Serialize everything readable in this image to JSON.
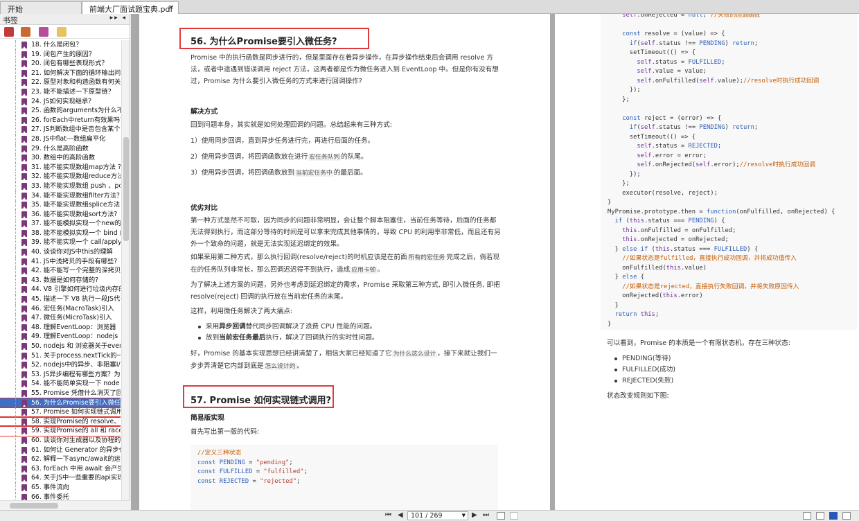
{
  "tabs": [
    {
      "label": "开始",
      "closable": false
    },
    {
      "label": "前端大厂面试题宝典.pdf",
      "closable": true,
      "close_glyph": "×"
    }
  ],
  "sidebar": {
    "title": "书签",
    "collapse_glyph": "▸▸ ◂",
    "bookmarks": [
      {
        "label": "18. 什么是闭包？"
      },
      {
        "label": "19. 闭包产生的原因？"
      },
      {
        "label": "20. 闭包有哪些表现形式？"
      },
      {
        "label": "21. 如何解决下面的循环输出问题"
      },
      {
        "label": "22. 原型对象和构造函数有何关系"
      },
      {
        "label": "23. 能不能描述一下原型链？"
      },
      {
        "label": "24. JS如何实现继承？"
      },
      {
        "label": "25. 函数的arguments为什么不是"
      },
      {
        "label": "26. forEach中return有效果吗？如"
      },
      {
        "label": "27. JS判断数组中是否包含某个值"
      },
      {
        "label": "28. JS中flat---数组扁平化"
      },
      {
        "label": "29. 什么是高阶函数"
      },
      {
        "label": "30. 数组中的高阶函数"
      },
      {
        "label": "31. 能不能实现数组map方法 ?"
      },
      {
        "label": "32. 能不能实现数组reduce方法"
      },
      {
        "label": "33. 能不能实现数组 push 、pop"
      },
      {
        "label": "34. 能不能实现数组filter方法？"
      },
      {
        "label": "35. 能不能实现数组splice方法 ?"
      },
      {
        "label": "36. 能不能实现数组sort方法?"
      },
      {
        "label": "37. 能不能模拟实现一个new的效"
      },
      {
        "label": "38. 能不能模拟实现一个 bind 的效"
      },
      {
        "label": "39. 能不能实现一个 call/apply 函"
      },
      {
        "label": "40. 谈谈你对JS中this的理解"
      },
      {
        "label": "41. JS中浅拷贝的手段有哪些?"
      },
      {
        "label": "42. 能不能写一个完整的深拷贝?"
      },
      {
        "label": "43. 数据是如何存储的?"
      },
      {
        "label": "44. V8 引擎如何进行垃圾内存的回"
      },
      {
        "label": "45. 描述一下 V8 执行一段JS代码"
      },
      {
        "label": "46. 宏任务(MacroTask)引入"
      },
      {
        "label": "47. 微任务(MicroTask)引入"
      },
      {
        "label": "48. 理解EventLoop：浏览器"
      },
      {
        "label": "49. 理解EventLoop：nodejs"
      },
      {
        "label": "50. nodejs 和 浏览器关于eventL"
      },
      {
        "label": "51. 关于process.nextTick的一点"
      },
      {
        "label": "52. nodejs中的异步、非阻塞I/O"
      },
      {
        "label": "53. JS异步编程有哪些方案？为什"
      },
      {
        "label": "54. 能不能简单实现一下 node 中"
      },
      {
        "label": "55. Promise 凭借什么消灭了回调"
      },
      {
        "label": "56. 为什么Promise要引入微任务"
      },
      {
        "label": "57. Promise 如何实现链式调用?"
      },
      {
        "label": "58. 实现Promise的 resolve、reje"
      },
      {
        "label": "59. 实现Promise的 all 和 race"
      },
      {
        "label": "60. 谈谈你对生成器以及协程的理"
      },
      {
        "label": "61. 如何让 Generator 的异步代码"
      },
      {
        "label": "62. 解释一下async/await的运行机"
      },
      {
        "label": "63. forEach 中用 await 会产生什"
      },
      {
        "label": "64. 关于JS中一些重要的api实现"
      },
      {
        "label": "65. 事件流向"
      },
      {
        "label": "66. 事件委托"
      }
    ],
    "selected_label": "56. 为什么Promise要引入微任务"
  },
  "left_page": {
    "h56": "56. 为什么Promise要引入微任务?",
    "intro": "Promise 中的执行函数是同步进行的，但是里面存在着异步操作，在异步操作结束后会调用 resolve 方法，或者中途遇到错误调用 reject 方法，这两者都是作为微任务进入到 EventLoop 中。但是你有没有想过，Promise 为什么要引入微任务的方式来进行回调操作?",
    "solution_title": "解决方式",
    "solution_intro": "回到问题本身，其实就是如何处理回调的问题。总结起来有三种方式:",
    "s1": "1）使用同步回调，直到异步任务进行完，再进行后面的任务。",
    "s2a": "2）使用异步回调，将回调函数放在进行",
    "s2b": "宏任务队列",
    "s2c": "的队尾。",
    "s3a": "3）使用异步回调，将回调函数放到",
    "s3b": "当前宏任务中",
    "s3c": "的最后面。",
    "compare_title": "优劣对比",
    "c1": "第一种方式显然不可取，因为同步的问题非常明显，会让整个脚本阻塞住，当前任务等待，后面的任务都无法得到执行，而这部分等待的时间是可以拿来完成其他事情的，导致 CPU 的利用率非常低，而且还有另外一个致命的问题，就是无法实现延迟绑定的效果。",
    "c2a": "如果采用第二种方式，那么执行回调(resolve/reject)的时机应该是在前面",
    "c2b": "所有的宏任务",
    "c2c": "完成之后，倘若现在的任务队列非常长，那么回调迟迟得不到执行，造成",
    "c2d": "应用卡顿",
    "c2e": "。",
    "c3": "为了解决上述方案的问题，另外也考虑到延迟绑定的需求，Promise 采取第三种方式, 即引入微任务, 即把 resolve(reject) 回调的执行放在当前宏任务的末尾。",
    "c4": "这样，利用微任务解决了两大痛点:",
    "b1a": "采用",
    "b1b": "异步回调",
    "b1c": "替代同步回调解决了浪费 CPU 性能的问题。",
    "b2a": "放到",
    "b2b": "当前宏任务最后",
    "b2c": "执行，解决了回调执行的实时性问题。",
    "c5a": "好，Promise 的基本实现思想已经讲清楚了，相信大家已经知道了它",
    "c5b": "为什么这么设计",
    "c5c": "，接下来就让我们一步步弄清楚它内部到底是",
    "c5d": "怎么设计的",
    "c5e": "。",
    "h57": "57. Promise 如何实现链式调用?",
    "simple_title": "简易版实现",
    "first_ver": "首先写出第一版的代码:",
    "code_lines": [
      "//定义三种状态",
      "const PENDING = \"pending\";",
      "const FULFILLED = \"fulfilled\";",
      "const REJECTED = \"rejected\";"
    ]
  },
  "right_page": {
    "code_lines": [
      "    self.onRejected = null; //失败的回调函数",
      "",
      "    const resolve = (value) => {",
      "      if(self.status !== PENDING) return;",
      "      setTimeout(() => {",
      "        self.status = FULFILLED;",
      "        self.value = value;",
      "        self.onFulfilled(self.value);//resolve时执行成功回调",
      "      });",
      "    };",
      "",
      "    const reject = (error) => {",
      "      if(self.status !== PENDING) return;",
      "      setTimeout(() => {",
      "        self.status = REJECTED;",
      "        self.error = error;",
      "        self.onRejected(self.error);//resolve时执行成功回调",
      "      });",
      "    };",
      "    executor(resolve, reject);",
      "}",
      "MyPromise.prototype.then = function(onFulfilled, onRejected) {",
      "  if (this.status === PENDING) {",
      "    this.onFulfilled = onFulfilled;",
      "    this.onRejected = onRejected;",
      "  } else if (this.status === FULFILLED) {",
      "    //如果状态是fulfilled，直接执行成功回调，并将成功值传入",
      "    onFulfilled(this.value)",
      "  } else {",
      "    //如果状态是rejected，直接执行失败回调，并将失败原因传入",
      "    onRejected(this.error)",
      "  }",
      "  return this;",
      "}"
    ],
    "summary": "可以看到，Promise 的本质是一个有限状态机，存在三种状态:",
    "states": [
      "PENDING(等待)",
      "FULFILLED(成功)",
      "REJECTED(失败)"
    ],
    "rule": "状态改变规则如下图:"
  },
  "statusbar": {
    "page_value": "101 / 269",
    "first_glyph": "⏮",
    "prev_glyph": "◀",
    "next_glyph": "▶",
    "last_glyph": "⏭"
  },
  "colors": {
    "selection": "#3d6fc4",
    "redbox": "#e23a3a",
    "viewer_bg": "#a9a9a9"
  }
}
